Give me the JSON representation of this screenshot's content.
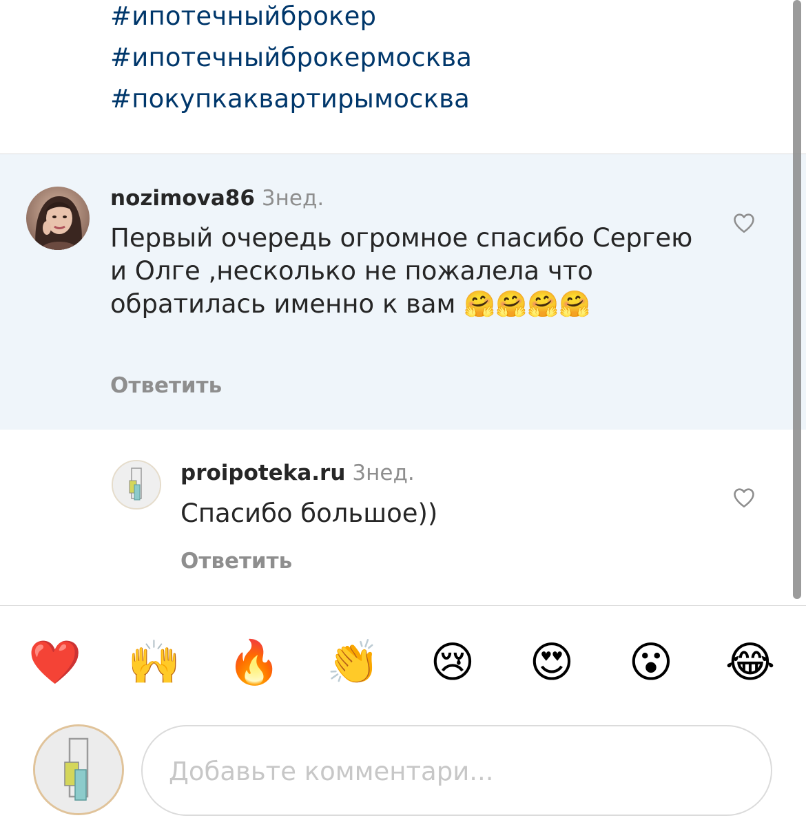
{
  "hashtags": [
    "#ипотечныйброкер",
    "#ипотечныйброкермосква",
    "#покупкаквартирымосква"
  ],
  "colors": {
    "hashtag": "#00376b",
    "highlight_background": "#eff5fa",
    "secondary_text": "#8e8e8e",
    "primary_text": "#262626",
    "divider": "#dbdbdb"
  },
  "comments": [
    {
      "username": "nozimova86",
      "time": "3нед.",
      "text": "Первый очередь огромное спасибо Сергею и Олге ,несколько не пожалела что обратилась именно к вам 🤗🤗🤗🤗",
      "reply_label": "Ответить",
      "like_icon": "heart-outline-icon",
      "highlighted": true
    },
    {
      "username": "proipoteka.ru",
      "time": "3нед.",
      "text": "Спасибо большое))",
      "reply_label": "Ответить",
      "like_icon": "heart-outline-icon",
      "highlighted": false
    }
  ],
  "reactions": [
    "❤️",
    "🙌",
    "🔥",
    "👏",
    "😢",
    "😍",
    "😮",
    "😂"
  ],
  "input": {
    "placeholder": "Добавьте комментари..."
  }
}
